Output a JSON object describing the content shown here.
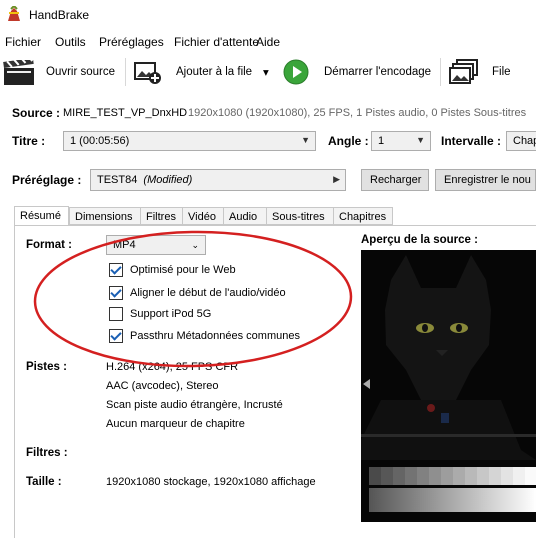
{
  "window": {
    "title": "HandBrake"
  },
  "menu": [
    "Fichier",
    "Outils",
    "Préréglages",
    "Fichier d'attente",
    "Aide"
  ],
  "toolbar": {
    "open_source": "Ouvrir source",
    "add_to_queue": "Ajouter à la file",
    "dropdown": "▾",
    "start_encode": "Démarrer l'encodage",
    "queue": "File"
  },
  "source": {
    "label": "Source :",
    "name": "MIRE_TEST_VP_DnxHD",
    "details": "1920x1080 (1920x1080), 25 FPS, 1 Pistes audio, 0 Pistes Sous-titres"
  },
  "title_row": {
    "title_label": "Titre :",
    "title_value": "1 (00:05:56)",
    "angle_label": "Angle :",
    "angle_value": "1",
    "range_label": "Intervalle :",
    "range_value": "Chap"
  },
  "preset": {
    "label": "Préréglage :",
    "value": "TEST84",
    "modified": "(Modified)",
    "reload_button": "Recharger",
    "save_button": "Enregistrer le nou"
  },
  "tabs": [
    "Résumé",
    "Dimensions",
    "Filtres",
    "Vidéo",
    "Audio",
    "Sous-titres",
    "Chapitres"
  ],
  "summary": {
    "format_label": "Format :",
    "format_value": "MP4",
    "options": [
      {
        "label": "Optimisé pour le Web",
        "checked": true
      },
      {
        "label": "Aligner le début de l'audio/vidéo",
        "checked": true
      },
      {
        "label": "Support iPod 5G",
        "checked": false
      },
      {
        "label": "Passthru Métadonnées communes",
        "checked": true
      }
    ],
    "tracks_label": "Pistes :",
    "tracks": [
      "H.264 (x264), 25 FPS CFR",
      "AAC (avcodec), Stereo",
      "Scan piste audio étrangère, Incrusté",
      "Aucun marqueur de chapitre"
    ],
    "filters_label": "Filtres :",
    "size_label": "Taille :",
    "size_value": "1920x1080 stockage, 1920x1080 affichage"
  },
  "preview": {
    "label": "Aperçu de la source :"
  },
  "colors": {
    "annotation": "#d42020",
    "check": "#1a5fb4",
    "start_green": "#3aa53a"
  }
}
